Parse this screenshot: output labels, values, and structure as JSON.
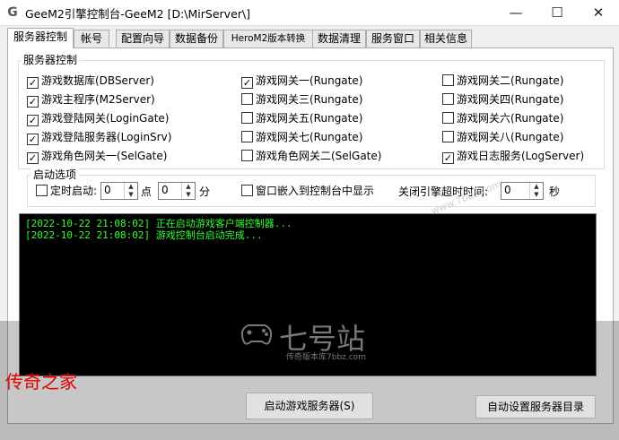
{
  "window": {
    "icon": "G",
    "title": "GeeM2引擎控制台-GeeM2 [D:\\MirServer\\]",
    "minimize_glyph": "—",
    "maximize_glyph": "☐",
    "close_glyph": "✕"
  },
  "tabs": [
    "服务器控制",
    "帐号",
    "配置向导",
    "数据备份",
    "HeroM2版本转换",
    "数据清理",
    "服务窗口",
    "相关信息"
  ],
  "server_control": {
    "legend": "服务器控制",
    "checkboxes": [
      {
        "label": "游戏数据库(DBServer)",
        "checked": true
      },
      {
        "label": "游戏主程序(M2Server)",
        "checked": true
      },
      {
        "label": "游戏登陆网关(LoginGate)",
        "checked": true
      },
      {
        "label": "游戏登陆服务器(LoginSrv)",
        "checked": true
      },
      {
        "label": "游戏角色网关一(SelGate)",
        "checked": true
      },
      {
        "label": "游戏网关一(Rungate)",
        "checked": true
      },
      {
        "label": "游戏网关三(Rungate)",
        "checked": false
      },
      {
        "label": "游戏网关五(Rungate)",
        "checked": false
      },
      {
        "label": "游戏网关七(Rungate)",
        "checked": false
      },
      {
        "label": "游戏角色网关二(SelGate)",
        "checked": false
      },
      {
        "label": "游戏网关二(Rungate)",
        "checked": false
      },
      {
        "label": "游戏网关四(Rungate)",
        "checked": false
      },
      {
        "label": "游戏网关六(Rungate)",
        "checked": false
      },
      {
        "label": "游戏网关八(Rungate)",
        "checked": false
      },
      {
        "label": "游戏日志服务(LogServer)",
        "checked": true
      }
    ]
  },
  "startup": {
    "legend": "启动选项",
    "timed_start_label": "定时启动:",
    "timed_start_checked": false,
    "hour_value": "0",
    "hour_unit": "点",
    "minute_value": "0",
    "minute_unit": "分",
    "embed_label": "窗口嵌入到控制台中显示",
    "embed_checked": false,
    "timeout_label": "关闭引擎超时时间:",
    "timeout_value": "0",
    "timeout_unit": "秒"
  },
  "log": [
    "[2022-10-22 21:08:02] 正在启动游戏客户端控制器...",
    "[2022-10-22 21:08:02] 游戏控制台启动完成..."
  ],
  "watermark": {
    "brand": "七号站",
    "sub": "传奇版本库7bbz.com",
    "diagonal": "www.7bbz.com"
  },
  "buttons": {
    "start_server": "启动游戏服务器(S)",
    "auto_config_dir": "自动设置服务器目录"
  },
  "overlay_label": "传奇之家",
  "colors": {
    "log_text": "#33ff33",
    "log_bg": "#000000",
    "overlay_label": "#e00000"
  }
}
